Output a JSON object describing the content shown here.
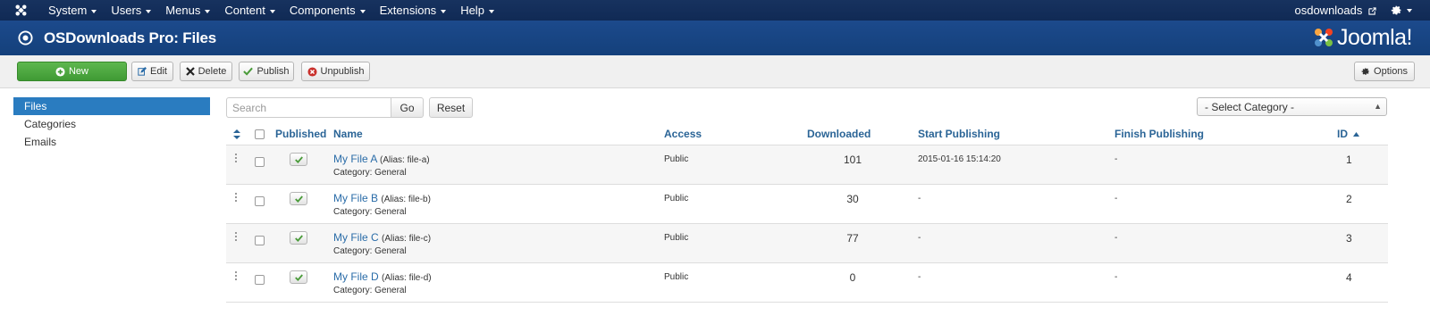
{
  "navbar": {
    "menu": [
      {
        "label": "System"
      },
      {
        "label": "Users"
      },
      {
        "label": "Menus"
      },
      {
        "label": "Content"
      },
      {
        "label": "Components"
      },
      {
        "label": "Extensions"
      },
      {
        "label": "Help"
      }
    ],
    "site_link": "osdownloads"
  },
  "header": {
    "title": "OSDownloads Pro: Files",
    "brand": "Joomla!"
  },
  "toolbar": {
    "new_label": "New",
    "edit_label": "Edit",
    "delete_label": "Delete",
    "publish_label": "Publish",
    "unpublish_label": "Unpublish",
    "options_label": "Options"
  },
  "sidebar": {
    "items": [
      {
        "label": "Files",
        "active": true
      },
      {
        "label": "Categories",
        "active": false
      },
      {
        "label": "Emails",
        "active": false
      }
    ]
  },
  "filters": {
    "search_placeholder": "Search",
    "go_label": "Go",
    "reset_label": "Reset",
    "category_selected": "- Select Category -"
  },
  "table": {
    "headers": {
      "published": "Published",
      "name": "Name",
      "access": "Access",
      "downloaded": "Downloaded",
      "start_publishing": "Start Publishing",
      "finish_publishing": "Finish Publishing",
      "id": "ID"
    },
    "rows": [
      {
        "name": "My File A",
        "alias": "(Alias: file-a)",
        "category": "Category: General",
        "access": "Public",
        "downloaded": "101",
        "start": "2015-01-16 15:14:20",
        "finish": "-",
        "id": "1"
      },
      {
        "name": "My File B",
        "alias": "(Alias: file-b)",
        "category": "Category: General",
        "access": "Public",
        "downloaded": "30",
        "start": "-",
        "finish": "-",
        "id": "2"
      },
      {
        "name": "My File C",
        "alias": "(Alias: file-c)",
        "category": "Category: General",
        "access": "Public",
        "downloaded": "77",
        "start": "-",
        "finish": "-",
        "id": "3"
      },
      {
        "name": "My File D",
        "alias": "(Alias: file-d)",
        "category": "Category: General",
        "access": "Public",
        "downloaded": "0",
        "start": "-",
        "finish": "-",
        "id": "4"
      }
    ]
  },
  "colors": {
    "navbar": "#17325f",
    "header": "#1c4a8c",
    "accent_link": "#2a6ca8",
    "new_button": "#4ea840",
    "sidebar_active": "#2a7cc0"
  }
}
